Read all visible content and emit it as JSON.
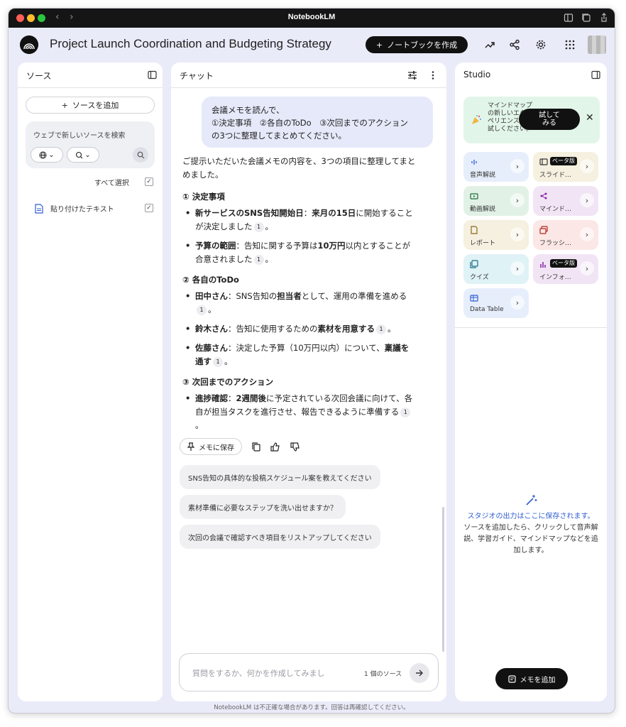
{
  "window": {
    "title": "NotebookLM"
  },
  "header": {
    "project_title": "Project Launch Coordination and Budgeting Strategy",
    "new_notebook_label": "ノートブックを作成"
  },
  "sources": {
    "title": "ソース",
    "add_label": "ソースを追加",
    "search_placeholder": "ウェブで新しいソースを検索",
    "select_all_label": "すべて選択",
    "items": [
      {
        "label": "貼り付けたテキスト"
      }
    ]
  },
  "chat": {
    "title": "チャット",
    "user_message": {
      "line1": "会議メモを読んで、",
      "line2": "①決定事項　②各自のToDo　③次回までのアクション",
      "line3": "の3つに整理してまとめてください。"
    },
    "answer": {
      "intro": "ご提示いただいた会議メモの内容を、3つの項目に整理してまとめました。",
      "sections": [
        {
          "heading": "① 決定事項",
          "items": [
            {
              "b1": "新サービスのSNS告知開始日",
              "t1": "：",
              "b2": "来月の15日",
              "t2": "に開始することが決定しました"
            },
            {
              "b1": "予算の範囲",
              "t1": "：告知に関する予算は",
              "b2": "10万円",
              "t2": "以内とすることが合意されました"
            }
          ]
        },
        {
          "heading": "② 各自のToDo",
          "items": [
            {
              "b1": "田中さん",
              "t1": "：SNS告知の",
              "b2": "担当者",
              "t2": "として、運用の準備を進める"
            },
            {
              "b1": "鈴木さん",
              "t1": "：告知に使用するための",
              "b2": "素材を用意する",
              "t2": ""
            },
            {
              "b1": "佐藤さん",
              "t1": "：決定した予算（10万円以内）について、",
              "b2": "稟議を通す",
              "t2": ""
            }
          ]
        },
        {
          "heading": "③ 次回までのアクション",
          "items": [
            {
              "b1": "進捗確認",
              "t1": "：",
              "b2": "2週間後",
              "t2": "に予定されている次回会議に向けて、各自が担当タスクを進行させ、報告できるように準備する"
            }
          ]
        }
      ],
      "citation": "1"
    },
    "save_note_label": "メモに保存",
    "suggestions": [
      "SNS告知の具体的な投稿スケジュール案を教えてください",
      "素材準備に必要なステップを洗い出せますか？",
      "次回の会議で確認すべき項目をリストアップしてください"
    ],
    "input_placeholder": "質問をするか、何かを作成してみまし",
    "source_count": "1 個のソース"
  },
  "studio": {
    "title": "Studio",
    "promo": {
      "text": "マインドマップの新しいエクスペリエンスをお試しください。",
      "try_label": "試して\nみる"
    },
    "tiles": [
      {
        "label": "音声解説",
        "beta": ""
      },
      {
        "label": "スライド…",
        "beta": "ベータ版"
      },
      {
        "label": "動画解説",
        "beta": ""
      },
      {
        "label": "マインド…",
        "beta": ""
      },
      {
        "label": "レポート",
        "beta": ""
      },
      {
        "label": "フラッシ…",
        "beta": ""
      },
      {
        "label": "クイズ",
        "beta": ""
      },
      {
        "label": "インフォ…",
        "beta": "ベータ版"
      },
      {
        "label": "Data Table",
        "beta": ""
      }
    ],
    "empty_title": "スタジオの出力はここに保存されます。",
    "empty_desc": "ソースを追加したら、クリックして音声解説、学習ガイド、マインドマップなどを追加します。",
    "add_memo_label": "メモを追加"
  },
  "footer": {
    "text": "NotebookLM は不正確な場合があります。回答は再確認してください。"
  },
  "colors": {
    "accent_blue": "#2f5cd1",
    "tile_blue": "#e7eefb",
    "tile_yellow": "#f5f0df",
    "tile_green": "#e1f1e6",
    "tile_purple": "#f1e5f5",
    "tile_pink": "#fbe7e5",
    "tile_cyan": "#dff2f6"
  }
}
